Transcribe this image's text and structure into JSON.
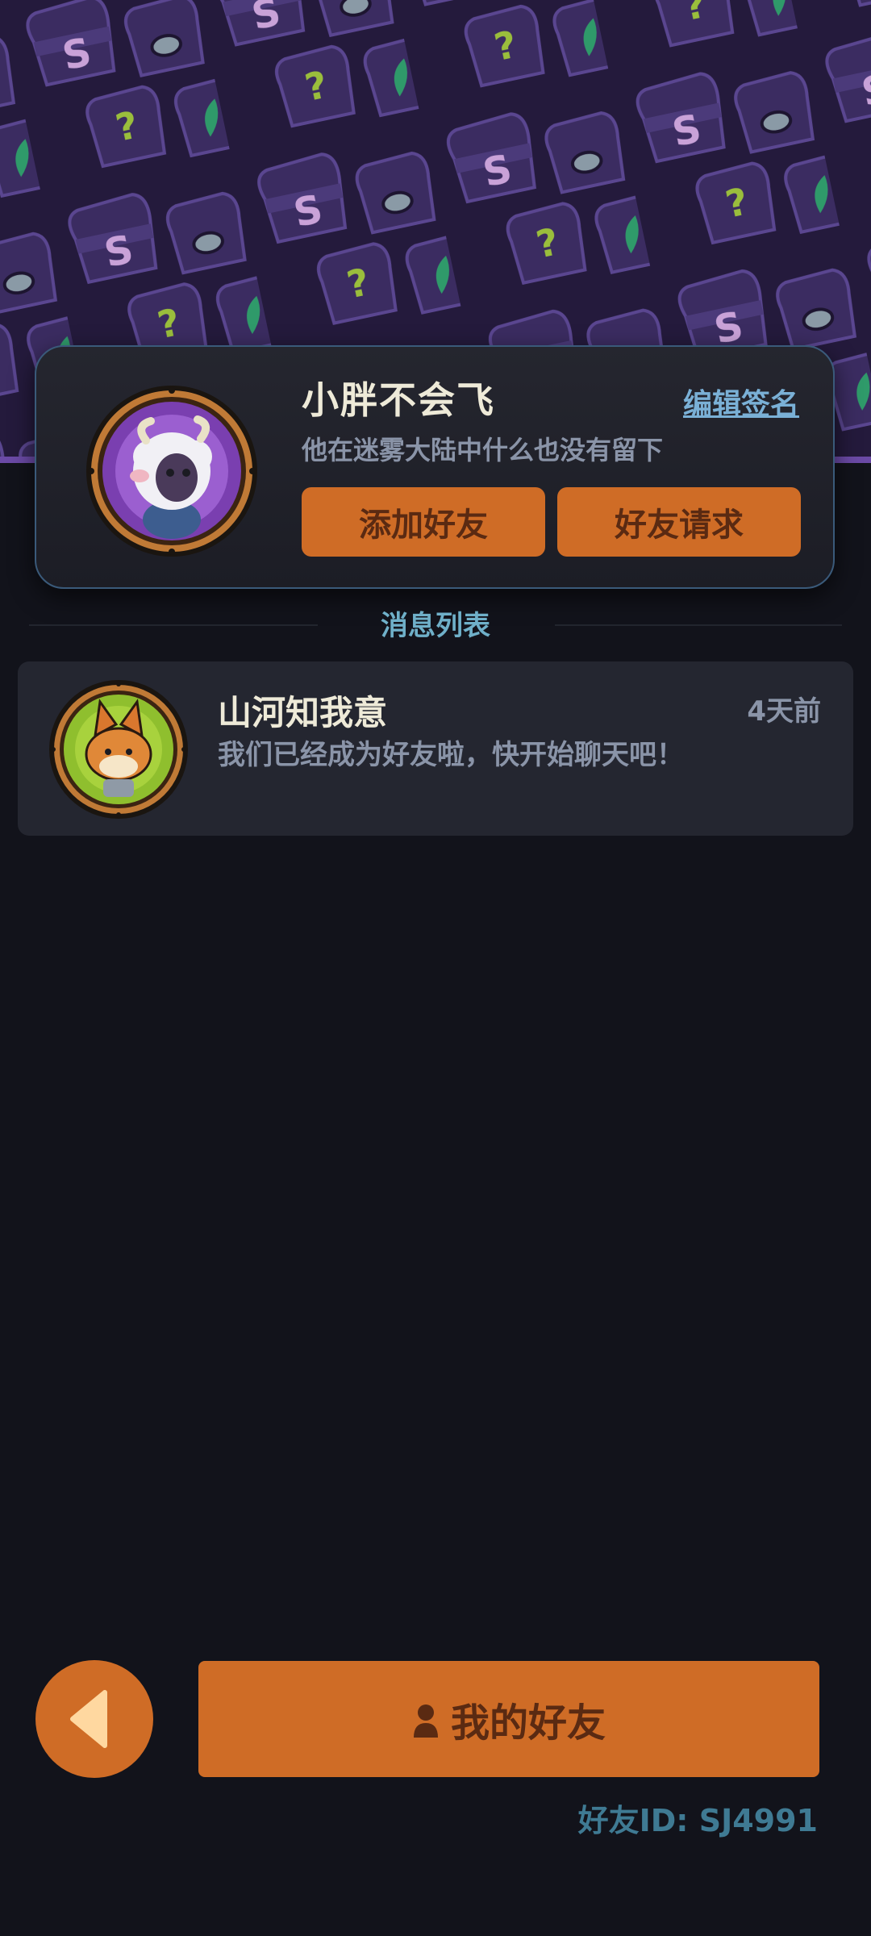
{
  "colors": {
    "background": "#12131b",
    "header_pattern": "#2a1f45",
    "accent_orange": "#cf6c26",
    "button_text": "#5a2a12",
    "link_blue": "#7ab0d6",
    "section_title": "#6fb0c9",
    "muted_text": "#8a94a8",
    "friend_id_text": "#3f7a93"
  },
  "profile": {
    "name": "小胖不会飞",
    "signature": "他在迷雾大陆中什么也没有留下",
    "edit_signature_label": "编辑签名",
    "avatar_icon": "sheep-avatar-icon",
    "add_friend_label": "添加好友",
    "friend_request_label": "好友请求"
  },
  "messages": {
    "title": "消息列表",
    "items": [
      {
        "name": "山河知我意",
        "time": "4天前",
        "text": "我们已经成为好友啦，快开始聊天吧！",
        "avatar_icon": "fox-avatar-icon"
      }
    ]
  },
  "bottom": {
    "back_icon": "back-arrow-icon",
    "my_friends_icon": "person-icon",
    "my_friends_label": "我的好友",
    "friend_id": "好友ID: SJ4991"
  }
}
